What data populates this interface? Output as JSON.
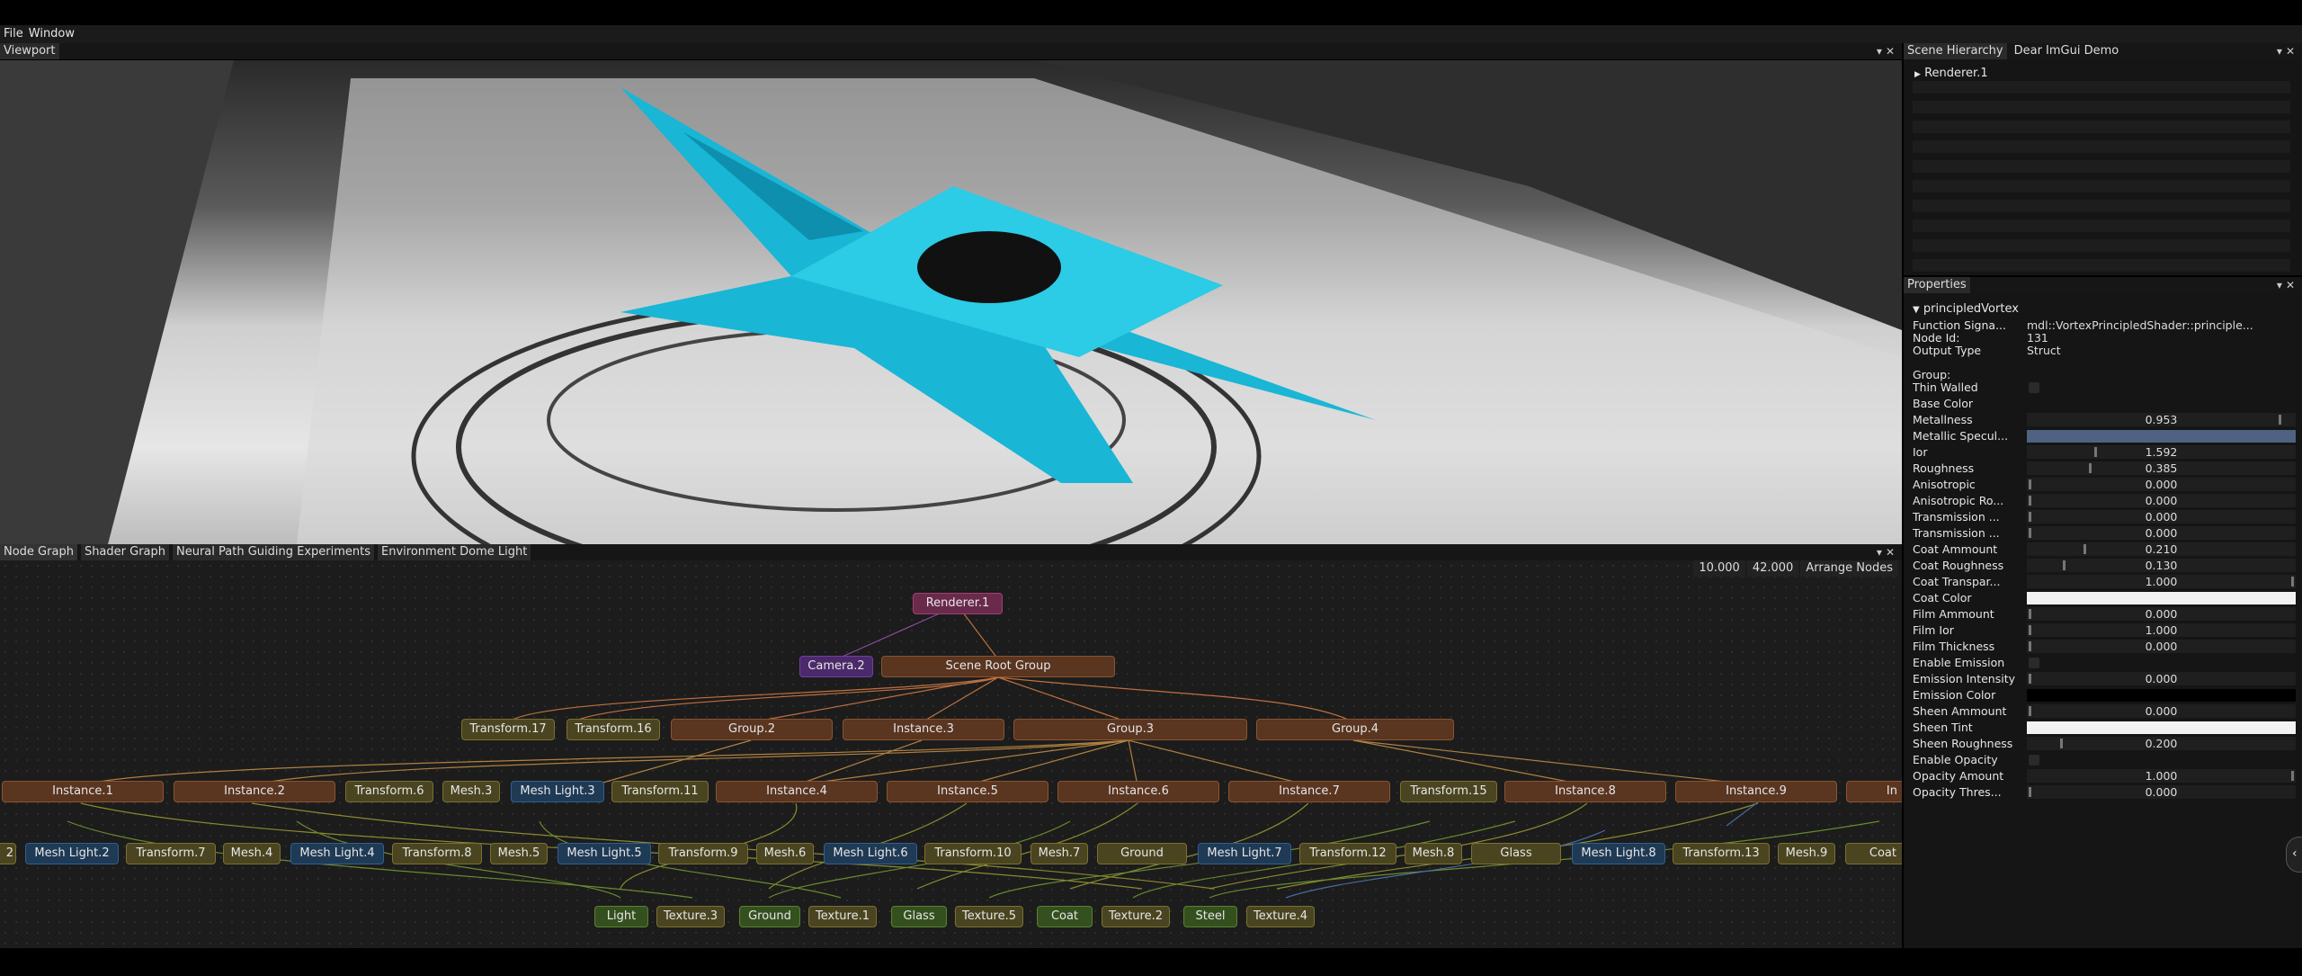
{
  "menubar": {
    "items": [
      "File",
      "Window"
    ]
  },
  "viewport": {
    "tab": "Viewport"
  },
  "graph": {
    "tabs": [
      "Node Graph",
      "Shader Graph",
      "Neural Path Guiding Experiments",
      "Environment Dome Light"
    ],
    "zoom": "10.000",
    "value2": "42.000",
    "arrange_label": "Arrange Nodes",
    "row0": [
      "Renderer.1"
    ],
    "row1": [
      "Camera.2",
      "Scene Root Group"
    ],
    "row2": [
      "Transform.17",
      "Transform.16",
      "Group.2",
      "Instance.3",
      "Group.3",
      "Group.4"
    ],
    "row3": [
      "Instance.1",
      "Instance.2",
      "Transform.6",
      "Mesh.3",
      "Mesh Light.3",
      "Transform.11",
      "Instance.4",
      "Instance.5",
      "Instance.6",
      "Instance.7",
      "Transform.15",
      "Instance.8",
      "Instance.9",
      "In"
    ],
    "row4": [
      "2",
      "Mesh Light.2",
      "Transform.7",
      "Mesh.4",
      "Mesh Light.4",
      "Transform.8",
      "Mesh.5",
      "Mesh Light.5",
      "Transform.9",
      "Mesh.6",
      "Mesh Light.6",
      "Transform.10",
      "Mesh.7",
      "Ground",
      "Mesh Light.7",
      "Transform.12",
      "Mesh.8",
      "Glass",
      "Mesh Light.8",
      "Transform.13",
      "Mesh.9",
      "Coat"
    ],
    "row5": [
      "Light",
      "Texture.3",
      "Ground",
      "Texture.1",
      "Glass",
      "Texture.5",
      "Coat",
      "Texture.2",
      "Steel",
      "Texture.4"
    ]
  },
  "scene": {
    "tabs": [
      "Scene Hierarchy",
      "Dear ImGui Demo"
    ],
    "root": "Renderer.1"
  },
  "props": {
    "tab": "Properties",
    "header": "principledVortex",
    "info": [
      {
        "label": "Function Signa...",
        "value": "mdl::VortexPrincipledShader::principle..."
      },
      {
        "label": "Node Id:",
        "value": "131"
      },
      {
        "label": "Output Type",
        "value": "Struct"
      }
    ],
    "group_label": "Group:",
    "rows": [
      {
        "label": "Thin Walled",
        "kind": "check"
      },
      {
        "label": "Base Color",
        "kind": "none"
      },
      {
        "label": "Metallness",
        "kind": "slider",
        "value": "0.953",
        "pos": 0.953
      },
      {
        "label": "Metallic Specul...",
        "kind": "color",
        "color": "#4f6282"
      },
      {
        "label": "Ior",
        "kind": "slider",
        "value": "1.592",
        "pos": 0.25
      },
      {
        "label": "Roughness",
        "kind": "slider",
        "value": "0.385",
        "pos": 0.23
      },
      {
        "label": "Anisotropic",
        "kind": "slider",
        "value": "0.000",
        "pos": 0
      },
      {
        "label": "Anisotropic Ro...",
        "kind": "slider",
        "value": "0.000",
        "pos": 0
      },
      {
        "label": "Transmission ...",
        "kind": "slider",
        "value": "0.000",
        "pos": 0
      },
      {
        "label": "Transmission ...",
        "kind": "slider",
        "value": "0.000",
        "pos": 0
      },
      {
        "label": "Coat Ammount",
        "kind": "slider",
        "value": "0.210",
        "pos": 0.21
      },
      {
        "label": "Coat Roughness",
        "kind": "slider",
        "value": "0.130",
        "pos": 0.13
      },
      {
        "label": "Coat Transpar...",
        "kind": "slider",
        "value": "1.000",
        "pos": 1
      },
      {
        "label": "Coat Color",
        "kind": "color",
        "color": "#f2f2f2"
      },
      {
        "label": "Film Ammount",
        "kind": "slider",
        "value": "0.000",
        "pos": 0
      },
      {
        "label": "Film Ior",
        "kind": "slider",
        "value": "1.000",
        "pos": 0
      },
      {
        "label": "Film Thickness",
        "kind": "slider",
        "value": "0.000",
        "pos": 0
      },
      {
        "label": "Enable Emission",
        "kind": "check"
      },
      {
        "label": "Emission Intensity",
        "kind": "slider",
        "value": "0.000",
        "pos": 0
      },
      {
        "label": "Emission Color",
        "kind": "color",
        "color": "#000000"
      },
      {
        "label": "Sheen Ammount",
        "kind": "slider",
        "value": "0.000",
        "pos": 0
      },
      {
        "label": "Sheen Tint",
        "kind": "color",
        "color": "#f2f2f2"
      },
      {
        "label": "Sheen Roughness",
        "kind": "slider",
        "value": "0.200",
        "pos": 0.12
      },
      {
        "label": "Enable Opacity",
        "kind": "check"
      },
      {
        "label": "Opacity Amount",
        "kind": "slider",
        "value": "1.000",
        "pos": 1
      },
      {
        "label": "Opacity Thres...",
        "kind": "slider",
        "value": "0.000",
        "pos": 0
      }
    ]
  }
}
